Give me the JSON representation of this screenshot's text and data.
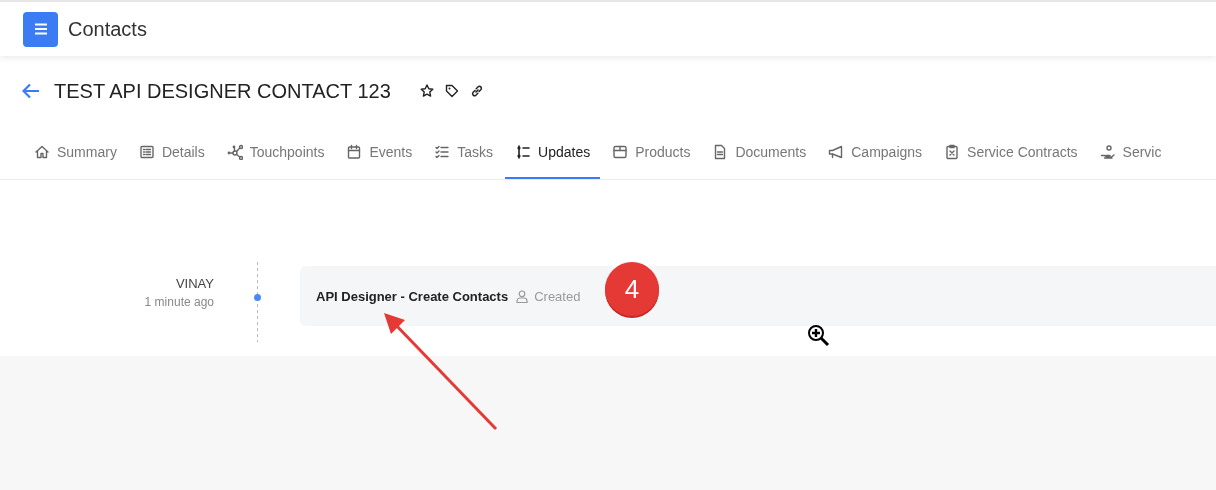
{
  "app_bar": {
    "title": "Contacts"
  },
  "record": {
    "title": "TEST API DESIGNER CONTACT 123"
  },
  "tabs": [
    {
      "label": "Summary",
      "kind": "home",
      "selected": false
    },
    {
      "label": "Details",
      "kind": "list",
      "selected": false
    },
    {
      "label": "Touchpoints",
      "kind": "network",
      "selected": false
    },
    {
      "label": "Events",
      "kind": "calendar",
      "selected": false
    },
    {
      "label": "Tasks",
      "kind": "checklist",
      "selected": false
    },
    {
      "label": "Updates",
      "kind": "timeline",
      "selected": true
    },
    {
      "label": "Products",
      "kind": "box",
      "selected": false
    },
    {
      "label": "Documents",
      "kind": "document",
      "selected": false
    },
    {
      "label": "Campaigns",
      "kind": "megaphone",
      "selected": false
    },
    {
      "label": "Service Contracts",
      "kind": "clipboard",
      "selected": false
    },
    {
      "label": "Servic",
      "kind": "hand",
      "selected": false
    }
  ],
  "updates": [
    {
      "author": "VINAY",
      "time": "1 minute ago",
      "title": "API Designer - Create Contacts",
      "action": "Created"
    }
  ],
  "annotation": {
    "badge": "4"
  }
}
